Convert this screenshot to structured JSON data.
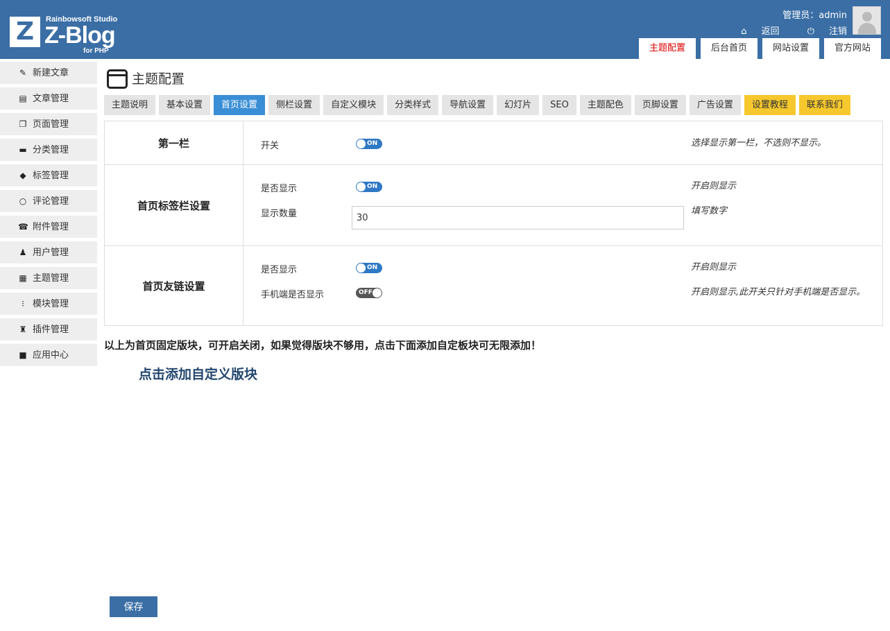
{
  "logo": {
    "mark": "Z",
    "studio": "Rainbowsoft Studio",
    "name": "Z-Blog",
    "sub": "for PHP"
  },
  "user": {
    "label": "管理员：admin",
    "back": "返回",
    "logout": "注销"
  },
  "top_tabs": [
    "主题配置",
    "后台首页",
    "网站设置",
    "官方网站"
  ],
  "sidebar": {
    "items": [
      {
        "label": "新建文章",
        "icon": "edit-icon"
      },
      {
        "label": "文章管理",
        "icon": "document-icon"
      },
      {
        "label": "页面管理",
        "icon": "pages-icon"
      },
      {
        "label": "分类管理",
        "icon": "folder-icon"
      },
      {
        "label": "标签管理",
        "icon": "tag-icon"
      },
      {
        "label": "评论管理",
        "icon": "comment-icon"
      },
      {
        "label": "附件管理",
        "icon": "attachment-icon"
      },
      {
        "label": "用户管理",
        "icon": "user-icon"
      },
      {
        "label": "主题管理",
        "icon": "theme-icon"
      },
      {
        "label": "模块管理",
        "icon": "module-icon"
      },
      {
        "label": "插件管理",
        "icon": "plugin-icon"
      },
      {
        "label": "应用中心",
        "icon": "box-icon"
      }
    ]
  },
  "page": {
    "title": "主题配置"
  },
  "tabs": [
    "主题说明",
    "基本设置",
    "首页设置",
    "侧栏设置",
    "自定义模块",
    "分类样式",
    "导航设置",
    "幻灯片",
    "SEO",
    "主题配色",
    "页脚设置",
    "广告设置",
    "设置教程",
    "联系我们"
  ],
  "sections": {
    "first": {
      "title": "第一栏",
      "switch_label": "开关",
      "switch_state": "ON",
      "switch_desc": "选择显示第一栏，不选则不显示。"
    },
    "tagbar": {
      "title": "首页标签栏设置",
      "show_label": "是否显示",
      "show_state": "ON",
      "show_desc": "开启则显示",
      "count_label": "显示数量",
      "count_value": "30",
      "count_desc": "填写数字"
    },
    "links": {
      "title": "首页友链设置",
      "show_label": "是否显示",
      "show_state": "ON",
      "show_desc": "开启则显示",
      "mobile_label": "手机端是否显示",
      "mobile_state": "OFF",
      "mobile_desc": "开启则显示,此开关只针对手机端是否显示。"
    }
  },
  "notice": "以上为首页固定版块，可开启关闭，如果觉得版块不够用，点击下面添加自定板块可无限添加！",
  "add_link": "点击添加自定义版块",
  "save_label": "保存",
  "colors": {
    "header": "#3a6ea5",
    "active_tab": "#3a8ed6",
    "highlight_tab": "#f6c82d",
    "toggle_on": "#2f78c4",
    "toggle_off": "#555555",
    "active_top_tab_text": "#dd0000"
  }
}
